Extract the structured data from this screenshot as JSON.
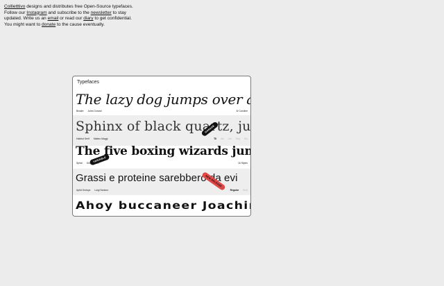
{
  "intro": {
    "brand": "Collletttivo",
    "t1": " designs and distributes free Open-Source typefaces. Follow our ",
    "instagram": "Instagram",
    "t2": " and subscribe to the ",
    "newsletter": "newsletter",
    "t3": " to stay updated. Write us an ",
    "email": "email",
    "t4": " or read our ",
    "diary": "diary",
    "t5": " to get confidential. You might want to ",
    "donate": "donate",
    "t6": " to the cause eventually."
  },
  "panel": {
    "title": "Typefaces",
    "rows": [
      {
        "sample": "The lazy dog jumps over a quick",
        "meta_left": [
          "Binaire",
          "Jules Durand"
        ],
        "meta_right": "8/ Caroline"
      },
      {
        "sample": "Sphinx of black quartz, judge",
        "meta_left": [
          "Habbut Serif",
          "Matteo Maggi"
        ],
        "styles": [
          "Tll",
          "Ital",
          "Lite",
          "Reg",
          "Bld"
        ],
        "badge": "GARAGE"
      },
      {
        "sample": "The five boxing wizards jump qui",
        "meta_left": [
          "Spiral",
          "Giulio Gheri"
        ],
        "meta_right": "16 Styles",
        "badge": "VARIABLE"
      },
      {
        "sample": "Grassi e proteine sarebbero da evi",
        "meta_left": [
          "Aptid Grotsys",
          "Luigi Santoro"
        ],
        "styles": [
          "Regular",
          "Bold"
        ],
        "badge": "NEW RELEASE"
      },
      {
        "sample": "Ahoy buccaneer Joachim",
        "meta_left": []
      }
    ]
  }
}
